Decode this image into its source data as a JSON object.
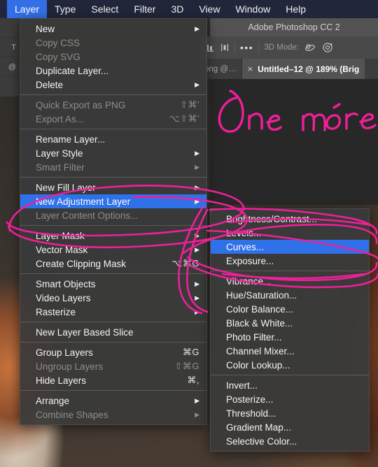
{
  "app": {
    "title": "Adobe Photoshop CC 2",
    "accent_blue": "#2f71e8",
    "menubar_bg": "#22263a",
    "annotation_color": "#ef1f9a"
  },
  "menubar": {
    "items": [
      {
        "label": "Layer",
        "active": true
      },
      {
        "label": "Type",
        "active": false
      },
      {
        "label": "Select",
        "active": false
      },
      {
        "label": "Filter",
        "active": false
      },
      {
        "label": "3D",
        "active": false
      },
      {
        "label": "View",
        "active": false
      },
      {
        "label": "Window",
        "active": false
      },
      {
        "label": "Help",
        "active": false
      }
    ]
  },
  "options_bar": {
    "mode_label": "3D Mode:",
    "overflow_label": "•••"
  },
  "tabbar": {
    "previous_tab": "ong @…",
    "active_tab": "Untitled–12 @ 189% (Brig",
    "close_glyph": "×"
  },
  "canvas": {
    "handwriting_text": "One more"
  },
  "tool_strip": {
    "visible_tool_letters": [
      "",
      "T",
      "@"
    ]
  },
  "layer_menu": {
    "groups": [
      {
        "items": [
          {
            "label": "New",
            "enabled": true,
            "submenu": true,
            "shortcut": ""
          },
          {
            "label": "Copy CSS",
            "enabled": false,
            "submenu": false,
            "shortcut": ""
          },
          {
            "label": "Copy SVG",
            "enabled": false,
            "submenu": false,
            "shortcut": ""
          },
          {
            "label": "Duplicate Layer...",
            "enabled": true,
            "submenu": false,
            "shortcut": ""
          },
          {
            "label": "Delete",
            "enabled": true,
            "submenu": true,
            "shortcut": ""
          }
        ]
      },
      {
        "items": [
          {
            "label": "Quick Export as PNG",
            "enabled": false,
            "submenu": false,
            "shortcut": "⇧⌘'"
          },
          {
            "label": "Export As...",
            "enabled": false,
            "submenu": false,
            "shortcut": "⌥⇧⌘'"
          }
        ]
      },
      {
        "items": [
          {
            "label": "Rename Layer...",
            "enabled": true,
            "submenu": false,
            "shortcut": ""
          },
          {
            "label": "Layer Style",
            "enabled": true,
            "submenu": true,
            "shortcut": ""
          },
          {
            "label": "Smart Filter",
            "enabled": false,
            "submenu": true,
            "shortcut": ""
          }
        ]
      },
      {
        "items": [
          {
            "label": "New Fill Layer",
            "enabled": true,
            "submenu": true,
            "shortcut": ""
          },
          {
            "label": "New Adjustment Layer",
            "enabled": true,
            "submenu": true,
            "shortcut": "",
            "selected": true
          },
          {
            "label": "Layer Content Options...",
            "enabled": false,
            "submenu": false,
            "shortcut": ""
          }
        ]
      },
      {
        "items": [
          {
            "label": "Layer Mask",
            "enabled": true,
            "submenu": true,
            "shortcut": ""
          },
          {
            "label": "Vector Mask",
            "enabled": true,
            "submenu": true,
            "shortcut": ""
          },
          {
            "label": "Create Clipping Mask",
            "enabled": true,
            "submenu": false,
            "shortcut": "⌥⌘G"
          }
        ]
      },
      {
        "items": [
          {
            "label": "Smart Objects",
            "enabled": true,
            "submenu": true,
            "shortcut": ""
          },
          {
            "label": "Video Layers",
            "enabled": true,
            "submenu": true,
            "shortcut": ""
          },
          {
            "label": "Rasterize",
            "enabled": true,
            "submenu": true,
            "shortcut": ""
          }
        ]
      },
      {
        "items": [
          {
            "label": "New Layer Based Slice",
            "enabled": true,
            "submenu": false,
            "shortcut": ""
          }
        ]
      },
      {
        "items": [
          {
            "label": "Group Layers",
            "enabled": true,
            "submenu": false,
            "shortcut": "⌘G"
          },
          {
            "label": "Ungroup Layers",
            "enabled": false,
            "submenu": false,
            "shortcut": "⇧⌘G"
          },
          {
            "label": "Hide Layers",
            "enabled": true,
            "submenu": false,
            "shortcut": "⌘,"
          }
        ]
      },
      {
        "items": [
          {
            "label": "Arrange",
            "enabled": true,
            "submenu": true,
            "shortcut": ""
          },
          {
            "label": "Combine Shapes",
            "enabled": false,
            "submenu": true,
            "shortcut": ""
          }
        ]
      }
    ]
  },
  "adjustment_submenu": {
    "groups": [
      {
        "items": [
          {
            "label": "Brightness/Contrast...",
            "enabled": true,
            "submenu": false,
            "shortcut": ""
          },
          {
            "label": "Levels...",
            "enabled": true,
            "submenu": false,
            "shortcut": ""
          },
          {
            "label": "Curves...",
            "enabled": true,
            "submenu": false,
            "shortcut": "",
            "selected": true
          },
          {
            "label": "Exposure...",
            "enabled": true,
            "submenu": false,
            "shortcut": ""
          }
        ]
      },
      {
        "items": [
          {
            "label": "Vibrance...",
            "enabled": true,
            "submenu": false,
            "shortcut": ""
          },
          {
            "label": "Hue/Saturation...",
            "enabled": true,
            "submenu": false,
            "shortcut": ""
          },
          {
            "label": "Color Balance...",
            "enabled": true,
            "submenu": false,
            "shortcut": ""
          },
          {
            "label": "Black & White...",
            "enabled": true,
            "submenu": false,
            "shortcut": ""
          },
          {
            "label": "Photo Filter...",
            "enabled": true,
            "submenu": false,
            "shortcut": ""
          },
          {
            "label": "Channel Mixer...",
            "enabled": true,
            "submenu": false,
            "shortcut": ""
          },
          {
            "label": "Color Lookup...",
            "enabled": true,
            "submenu": false,
            "shortcut": ""
          }
        ]
      },
      {
        "items": [
          {
            "label": "Invert...",
            "enabled": true,
            "submenu": false,
            "shortcut": ""
          },
          {
            "label": "Posterize...",
            "enabled": true,
            "submenu": false,
            "shortcut": ""
          },
          {
            "label": "Threshold...",
            "enabled": true,
            "submenu": false,
            "shortcut": ""
          },
          {
            "label": "Gradient Map...",
            "enabled": true,
            "submenu": false,
            "shortcut": ""
          },
          {
            "label": "Selective Color...",
            "enabled": true,
            "submenu": false,
            "shortcut": ""
          }
        ]
      }
    ]
  }
}
